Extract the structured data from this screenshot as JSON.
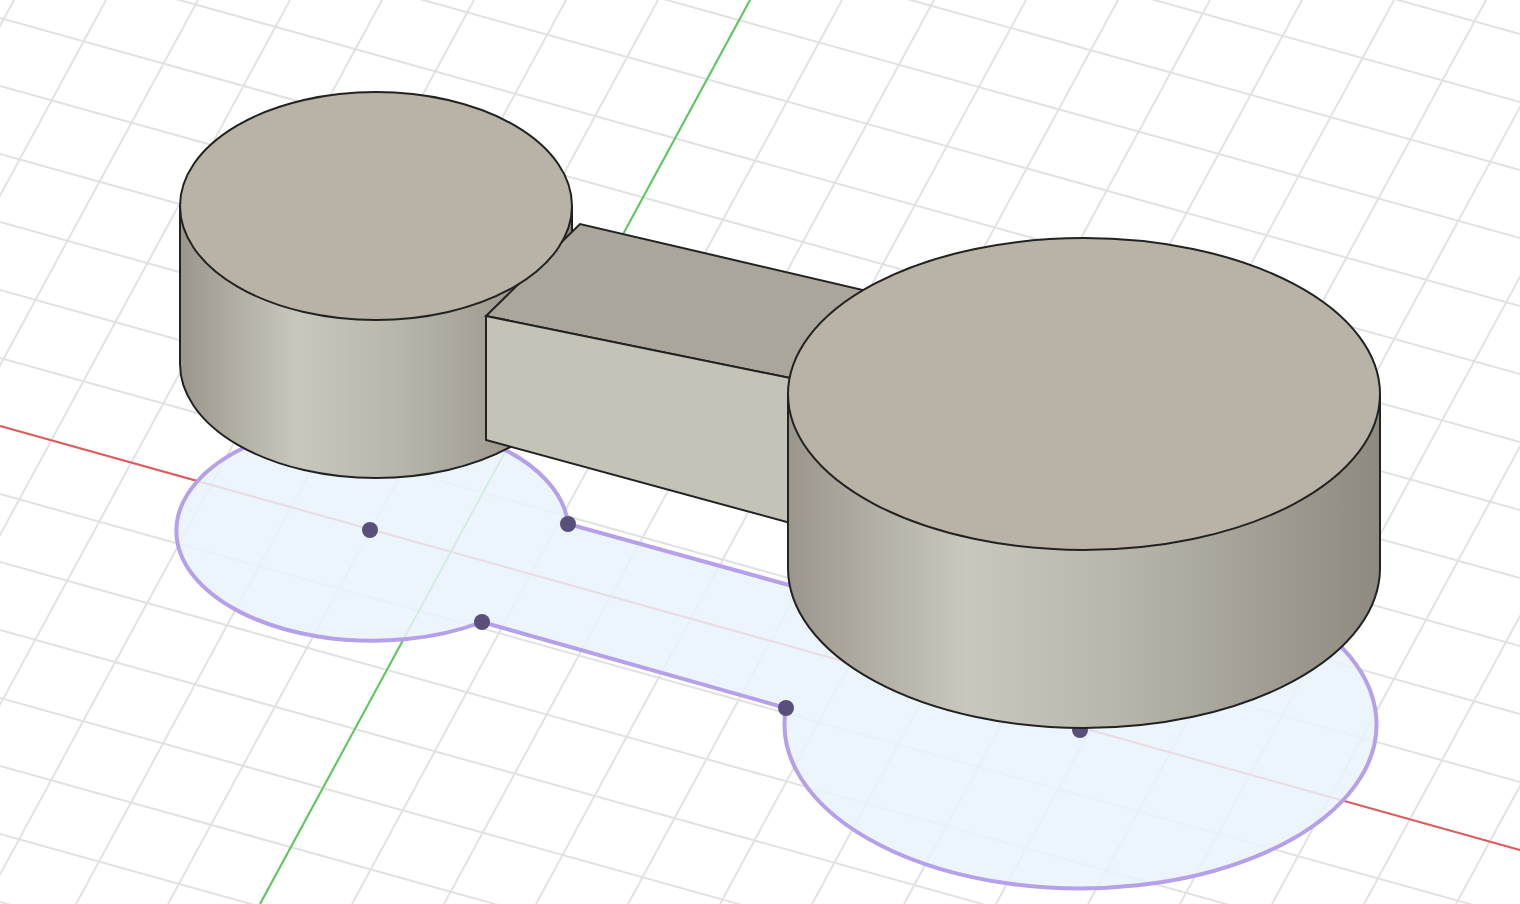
{
  "viewport": {
    "kind": "model-view",
    "sketch": {
      "visible": true
    }
  }
}
